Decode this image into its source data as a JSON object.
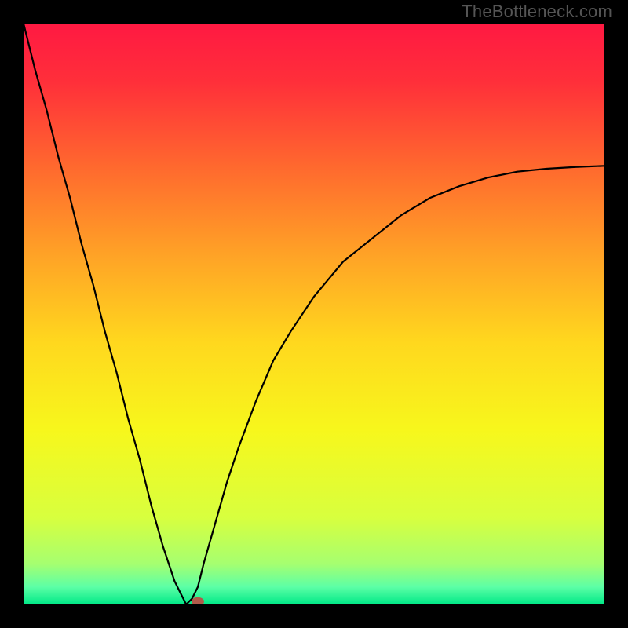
{
  "attribution": "TheBottleneck.com",
  "chart_data": {
    "type": "line",
    "title": "",
    "xlabel": "",
    "ylabel": "",
    "xlim": [
      0,
      100
    ],
    "ylim": [
      0,
      100
    ],
    "grid": false,
    "legend": false,
    "background": "rainbow-gradient",
    "gradient_stops": [
      {
        "pos": 0.0,
        "color": "#ff1942"
      },
      {
        "pos": 0.1,
        "color": "#ff2f3a"
      },
      {
        "pos": 0.25,
        "color": "#ff6a2e"
      },
      {
        "pos": 0.4,
        "color": "#ffa326"
      },
      {
        "pos": 0.55,
        "color": "#ffd81e"
      },
      {
        "pos": 0.7,
        "color": "#f7f71c"
      },
      {
        "pos": 0.85,
        "color": "#d8ff3e"
      },
      {
        "pos": 0.93,
        "color": "#a6ff70"
      },
      {
        "pos": 0.97,
        "color": "#5cffa6"
      },
      {
        "pos": 1.0,
        "color": "#00e887"
      }
    ],
    "series": [
      {
        "name": "bottleneck-curve",
        "stroke": "#000000",
        "stroke_width": 2.2,
        "x": [
          0,
          2,
          4,
          6,
          8,
          10,
          12,
          14,
          16,
          18,
          20,
          22,
          24,
          26,
          27,
          28,
          29,
          30,
          31,
          33,
          35,
          37,
          40,
          43,
          46,
          50,
          55,
          60,
          65,
          70,
          75,
          80,
          85,
          90,
          95,
          100
        ],
        "y": [
          100,
          92,
          85,
          77,
          70,
          62,
          55,
          47,
          40,
          32,
          25,
          17,
          10,
          4,
          2,
          0,
          1,
          3,
          7,
          14,
          21,
          27,
          35,
          42,
          47,
          53,
          59,
          63,
          67,
          70,
          72,
          73.5,
          74.5,
          75,
          75.3,
          75.5
        ]
      }
    ],
    "marker": {
      "x": 30,
      "y": 0.5,
      "color": "#b15a4a",
      "rx": 8,
      "ry": 5.5
    }
  }
}
